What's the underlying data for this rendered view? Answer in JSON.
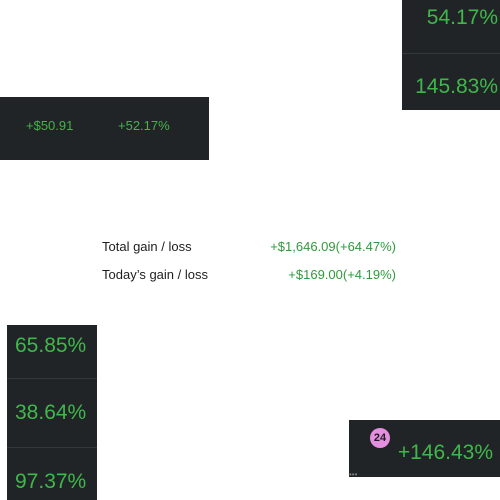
{
  "top_right_tile": {
    "items": [
      "54.17%",
      "145.83%"
    ]
  },
  "gain_strip": {
    "amount": "+$50.91",
    "percent": "+52.17%"
  },
  "summary": {
    "total_label": "Total gain / loss",
    "total_value": "+$1,646.09(+64.47%)",
    "today_label": "Today’s gain / loss",
    "today_value": "+$169.00(+4.19%)"
  },
  "left_column_tile": {
    "items": [
      "65.85%",
      "38.64%",
      "97.37%"
    ]
  },
  "bottom_right_tile": {
    "badge": "24",
    "value": "+146.43%"
  },
  "more_indicator": "•••",
  "colors": {
    "tile_background": "#202426",
    "gain_green": "#3fb84b",
    "summary_green": "#2e9a3a",
    "badge_pink": "#e58fe0"
  }
}
